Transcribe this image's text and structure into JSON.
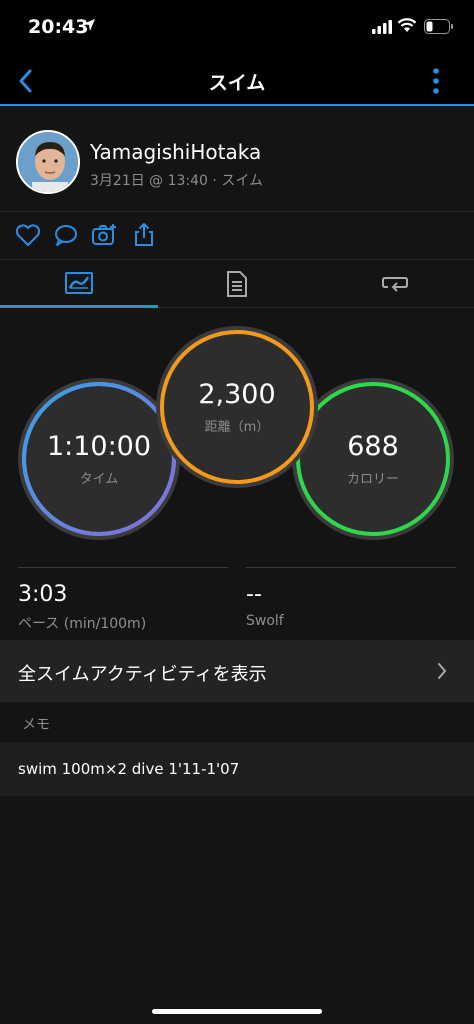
{
  "status_bar": {
    "time": "20:43"
  },
  "nav": {
    "title": "スイム"
  },
  "profile": {
    "name": "YamagishiHotaka",
    "subtitle": "3月21日 @ 13:40 · スイム"
  },
  "metrics": [
    {
      "value": "1:10:00",
      "label": "タイム",
      "color": "#3aa0e8"
    },
    {
      "value": "2,300",
      "label": "距離（m）",
      "color": "#f39a1e"
    },
    {
      "value": "688",
      "label": "カロリー",
      "color": "#2fd84a"
    }
  ],
  "stats": [
    {
      "value": "3:03",
      "label": "ペース (min/100m)"
    },
    {
      "value": "--",
      "label": "Swolf"
    }
  ],
  "show_all": {
    "label": "全スイムアクティビティを表示"
  },
  "memo": {
    "heading": "メモ",
    "text": "swim 100m×2 dive 1'11-1'07"
  },
  "colors": {
    "accent": "#2a8ee0"
  }
}
